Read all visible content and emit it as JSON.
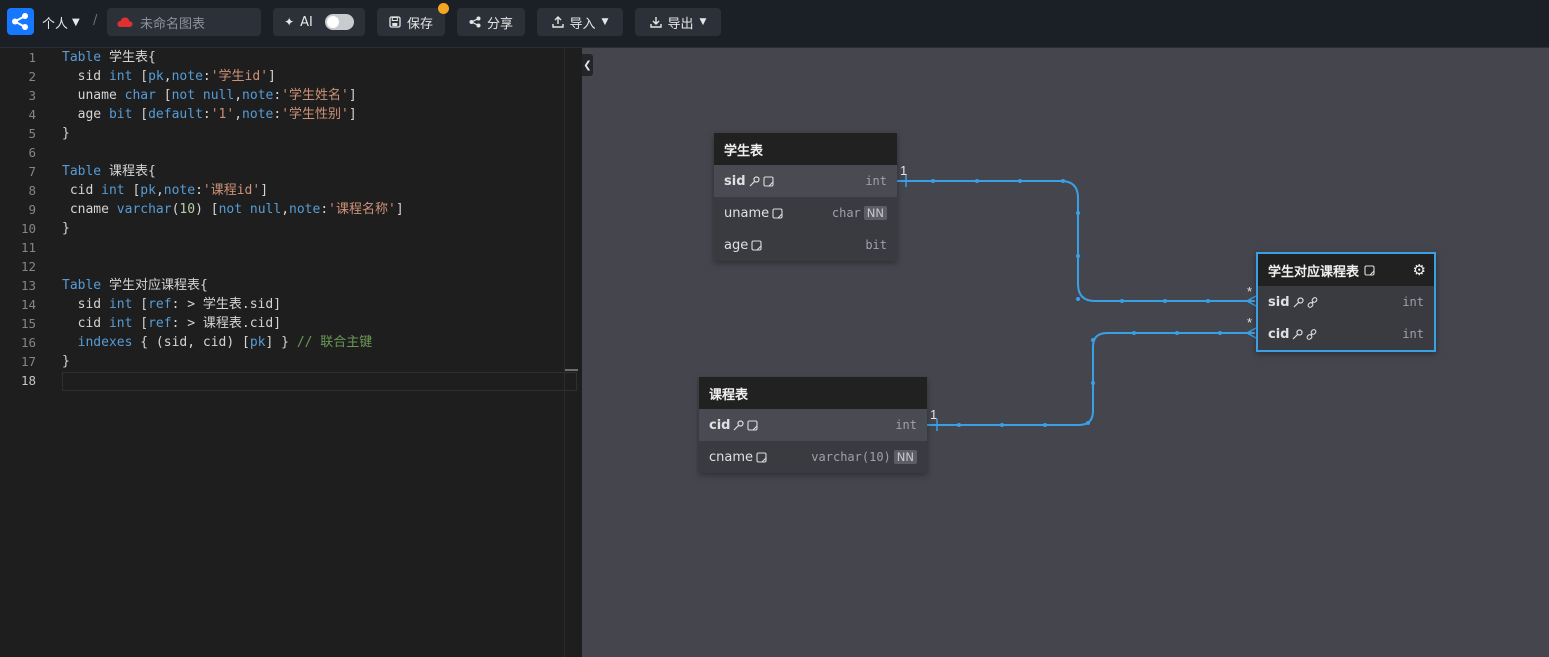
{
  "topbar": {
    "space_label": "个人",
    "separator": "/",
    "diagram_title_placeholder": "未命名图表",
    "ai_label": "AI",
    "save_label": "保存",
    "share_label": "分享",
    "import_label": "导入",
    "export_label": "导出"
  },
  "editor": {
    "line_numbers": [
      "1",
      "2",
      "3",
      "4",
      "5",
      "6",
      "7",
      "8",
      "9",
      "10",
      "11",
      "12",
      "13",
      "14",
      "15",
      "16",
      "17",
      "18"
    ],
    "active_line": "18"
  },
  "tables": {
    "students": {
      "name": "学生表",
      "fields": [
        {
          "name": "sid",
          "type": "int"
        },
        {
          "name": "uname",
          "type": "char",
          "badge": "NN"
        },
        {
          "name": "age",
          "type": "bit"
        }
      ]
    },
    "courses": {
      "name": "课程表",
      "fields": [
        {
          "name": "cid",
          "type": "int"
        },
        {
          "name": "cname",
          "type": "varchar(10)",
          "badge": "NN"
        }
      ]
    },
    "student_courses": {
      "name": "学生对应课程表",
      "fields": [
        {
          "name": "sid",
          "type": "int"
        },
        {
          "name": "cid",
          "type": "int"
        }
      ]
    }
  },
  "relations": {
    "one_label": "1",
    "many_label": "*"
  },
  "colors": {
    "accent": "#1677ff",
    "link": "#3aa0e6",
    "badge_dot": "#f5a623"
  }
}
